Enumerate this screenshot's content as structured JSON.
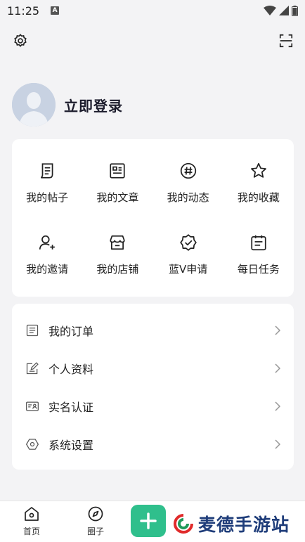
{
  "status_bar": {
    "time": "11:25",
    "notif_badge": "A"
  },
  "profile": {
    "login_text": "立即登录"
  },
  "grid": [
    {
      "label": "我的帖子",
      "icon": "post-icon"
    },
    {
      "label": "我的文章",
      "icon": "article-icon"
    },
    {
      "label": "我的动态",
      "icon": "hashtag-icon"
    },
    {
      "label": "我的收藏",
      "icon": "star-icon"
    },
    {
      "label": "我的邀请",
      "icon": "invite-user-icon"
    },
    {
      "label": "我的店铺",
      "icon": "store-icon"
    },
    {
      "label": "蓝V申请",
      "icon": "verified-badge-icon"
    },
    {
      "label": "每日任务",
      "icon": "calendar-task-icon"
    }
  ],
  "menu": [
    {
      "label": "我的订单",
      "icon": "order-icon"
    },
    {
      "label": "个人资料",
      "icon": "edit-profile-icon"
    },
    {
      "label": "实名认证",
      "icon": "id-card-icon"
    },
    {
      "label": "系统设置",
      "icon": "settings-hexagon-icon"
    }
  ],
  "bottom_nav": [
    {
      "label": "首页",
      "icon": "home-icon"
    },
    {
      "label": "圈子",
      "icon": "compass-icon"
    }
  ],
  "watermark": {
    "text": "麦德手游站"
  },
  "colors": {
    "accent": "#2fbf8c",
    "background": "#f3f3f5",
    "watermark": "#1f3d7a"
  }
}
